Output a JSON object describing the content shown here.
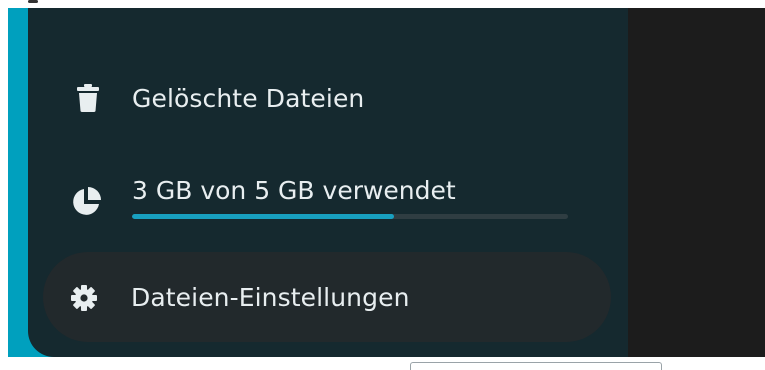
{
  "sidebar": {
    "deleted_files": {
      "label": "Gelöschte Dateien",
      "icon": "trash-icon"
    },
    "storage": {
      "label": "3 GB von 5 GB verwendet",
      "icon": "pie-chart-icon",
      "used_fraction": 0.6,
      "bar_color": "#18a0c0"
    },
    "settings": {
      "label": "Dateien-Einstellungen",
      "icon": "gear-icon"
    }
  },
  "colors": {
    "panel_background": "#15292f",
    "accent_teal": "#00a0be",
    "selected_background": "#22292c"
  }
}
